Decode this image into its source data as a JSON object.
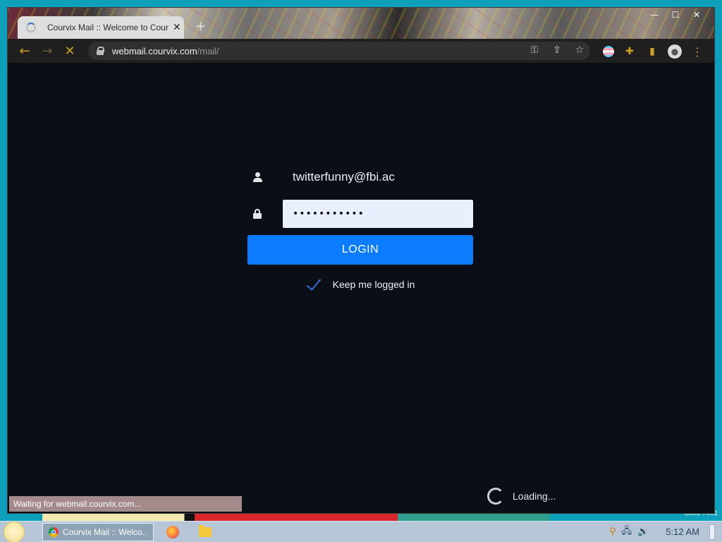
{
  "browser": {
    "tab_title": "Courvix Mail :: Welcome to Courvix Mail",
    "tab_close": "✕",
    "new_tab": "+",
    "url_host": "webmail.courvix.com",
    "url_path": "/mail/",
    "nav": {
      "back": "←",
      "forward": "→",
      "stop": "✕"
    },
    "window_controls": {
      "minimize": "—",
      "maximize": "☐",
      "close": "✕"
    },
    "status_text": "Waiting for webmail.courvix.com..."
  },
  "login": {
    "username": "twitterfunny@fbi.ac",
    "password_masked": "•••••••••••",
    "login_button": "LOGIN",
    "keep_logged_in": "Keep me logged in",
    "keep_logged_in_checked": true
  },
  "page": {
    "loading_text": "Loading..."
  },
  "taskbar": {
    "task_label": "Courvix Mail :: Welco...",
    "clock": "5:12 AM"
  },
  "desktop": {
    "build_text": "Build 7601"
  },
  "colors": {
    "accent": "#0b7cff",
    "page_bg": "#0a0e17",
    "chrome_accent": "#d0a020"
  }
}
